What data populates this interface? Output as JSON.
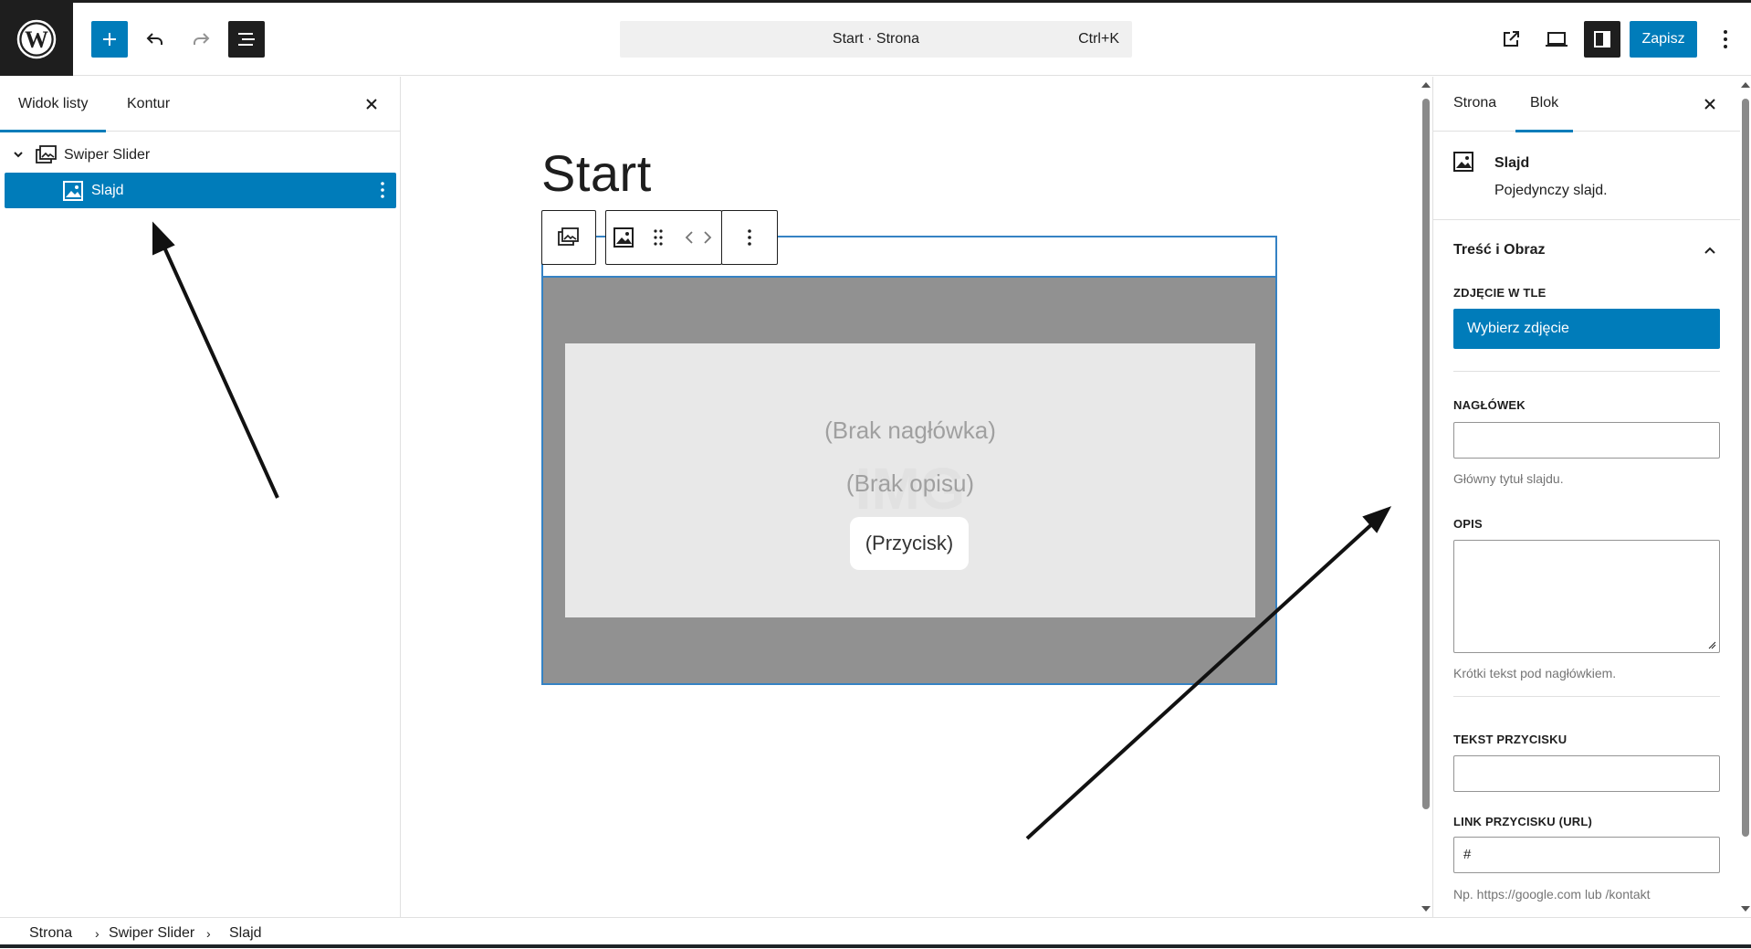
{
  "header": {
    "add_icon": "plus-icon",
    "command_bar": {
      "title": "Start · Strona",
      "shortcut": "Ctrl+K"
    },
    "save_label": "Zapisz"
  },
  "left_panel": {
    "tabs": [
      {
        "label": "Widok listy",
        "active": true
      },
      {
        "label": "Kontur",
        "active": false
      }
    ],
    "tree": [
      {
        "label": "Swiper Slider",
        "icon": "gallery-icon",
        "expanded": true
      },
      {
        "label": "Slajd",
        "icon": "image-icon",
        "selected": true
      }
    ]
  },
  "canvas": {
    "page_title": "Start",
    "slide": {
      "heading_placeholder": "(Brak nagłówka)",
      "description_placeholder": "(Brak opisu)",
      "watermark": "IMG",
      "button_placeholder": "(Przycisk)"
    }
  },
  "sidebar": {
    "tabs": [
      {
        "label": "Strona",
        "active": false
      },
      {
        "label": "Blok",
        "active": true
      }
    ],
    "block_card": {
      "title": "Slajd",
      "description": "Pojedynczy slajd."
    },
    "panel": {
      "title": "Treść i Obraz",
      "bg_image_label": "ZDJĘCIE W TLE",
      "choose_image_button": "Wybierz zdjęcie",
      "heading_label": "NAGŁÓWEK",
      "heading_value": "",
      "heading_help": "Główny tytuł slajdu.",
      "description_label": "OPIS",
      "description_value": "",
      "description_help": "Krótki tekst pod nagłówkiem.",
      "button_text_label": "TEKST PRZYCISKU",
      "button_text_value": "",
      "button_link_label": "LINK PRZYCISKU (URL)",
      "button_link_value": "#",
      "button_link_help": "Np. https://google.com lub /kontakt"
    }
  },
  "footer": {
    "breadcrumbs": [
      "Strona",
      "Swiper Slider",
      "Slajd"
    ]
  },
  "colors": {
    "accent": "#007cba",
    "dark": "#1e1e1e",
    "slide_bg": "#919191",
    "slide_inner": "#e8e8e8"
  }
}
